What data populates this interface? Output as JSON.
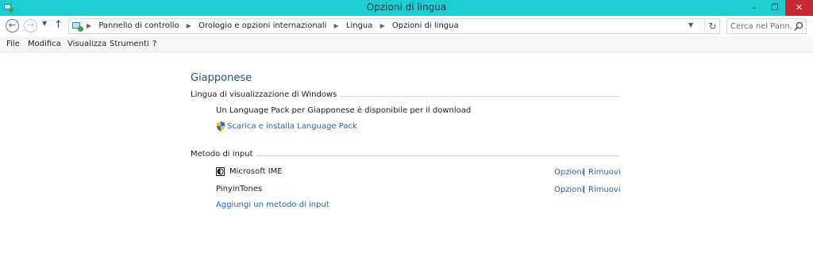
{
  "window": {
    "title": "Opzioni di lingua",
    "minimize": "–",
    "maximize": "❐",
    "close": "✕"
  },
  "nav": {
    "back": "←",
    "forward": "→",
    "recent": "▼",
    "up": "↑",
    "breadcrumbs": [
      "Pannello di controllo",
      "Orologio e opzioni internazionali",
      "Lingua",
      "Opzioni di lingua"
    ],
    "separator": "▶",
    "dropdown": "▼",
    "refresh": "↻",
    "search_placeholder": "Cerca nel Pann..."
  },
  "menu": {
    "items": [
      "File",
      "Modifica",
      "Visualizza",
      "Strumenti",
      "?"
    ]
  },
  "main": {
    "language": "Giapponese",
    "display_section": {
      "heading": "Lingua di visualizzazione di Windows",
      "message": "Un Language Pack per Giapponese è disponibile per il download",
      "download_link": "Scarica e installa Language Pack"
    },
    "input_section": {
      "heading": "Metodo di input",
      "methods": [
        {
          "name": "Microsoft IME",
          "options": "Opzioni",
          "remove": "Rimuovi"
        },
        {
          "name": "PinyinTones",
          "options": "Opzioni",
          "remove": "Rimuovi"
        }
      ],
      "pipe": "|",
      "add_link": "Aggiungi un metodo di input"
    }
  }
}
